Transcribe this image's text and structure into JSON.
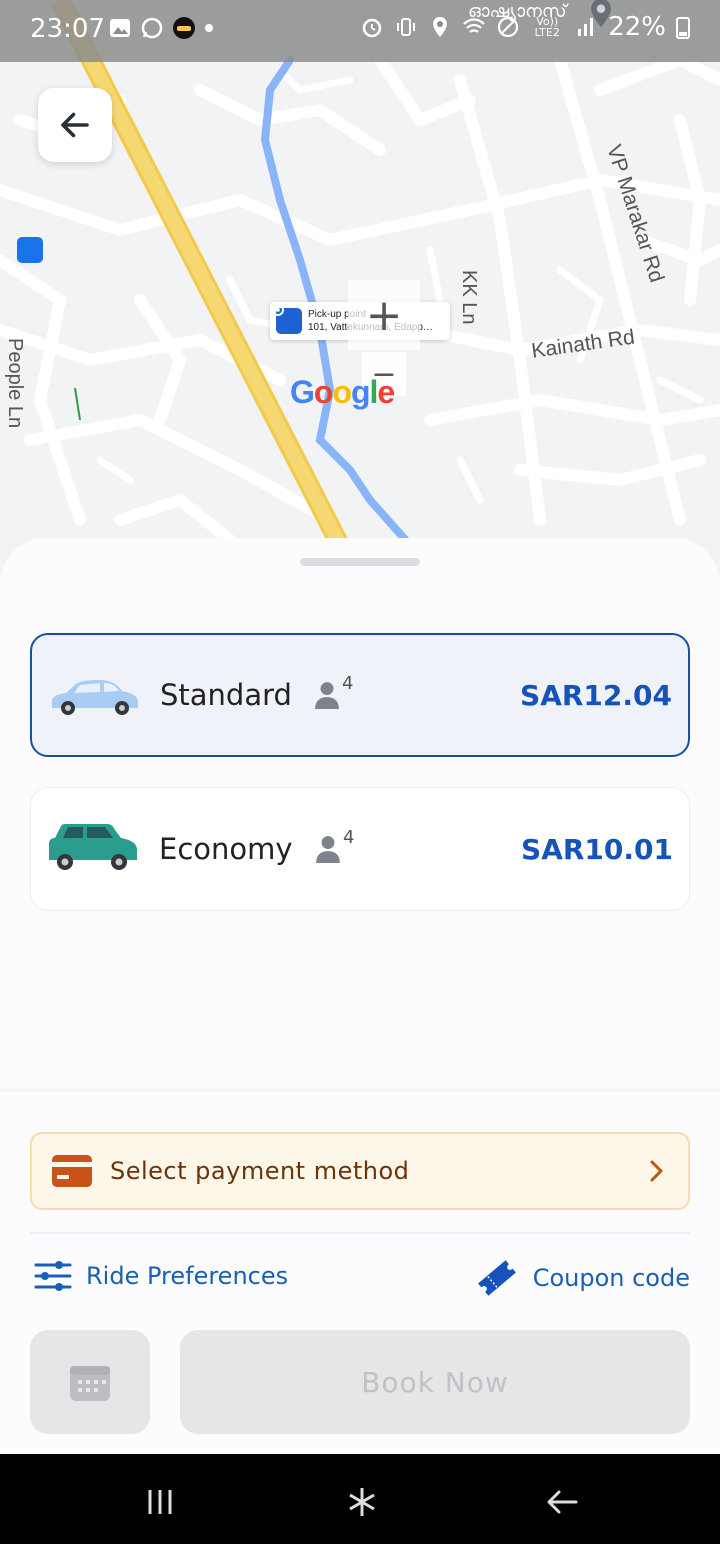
{
  "status_bar": {
    "time": "23:07",
    "battery": "22%",
    "network_label": "Vo)) LTE2",
    "place_label": "ഓഷ്യാനസ്"
  },
  "map": {
    "labels": {
      "kk_ln": "KK Ln",
      "vp_marakar_rd": "VP Marakar Rd",
      "kainath_rd": "Kainath Rd",
      "people_ln": "People Ln"
    },
    "pickup": {
      "title": "Pick-up point",
      "address": "101, Vattekunnam, Edapp…"
    },
    "zoom_in": "+",
    "zoom_out": "−",
    "logo": [
      "G",
      "o",
      "o",
      "g",
      "l",
      "e"
    ]
  },
  "rides": [
    {
      "name": "Standard",
      "seats": "4",
      "price": "SAR12.04",
      "selected": true,
      "color": "#a9cdf2"
    },
    {
      "name": "Economy",
      "seats": "4",
      "price": "SAR10.01",
      "selected": false,
      "color": "#2a9d8f"
    }
  ],
  "payment": {
    "label": "Select payment method"
  },
  "actions": {
    "ride_preferences": "Ride Preferences",
    "coupon_code": "Coupon code",
    "book_now": "Book Now"
  },
  "colors": {
    "accent": "#1553b8",
    "link": "#1760b5",
    "payment_text": "#6b3408",
    "payment_bg": "#fdf7ea"
  },
  "icons": {
    "back": "arrow-left-icon",
    "calendar": "calendar-icon",
    "card": "credit-card-icon",
    "sliders": "sliders-icon",
    "coupon": "ticket-icon",
    "person": "person-icon"
  }
}
